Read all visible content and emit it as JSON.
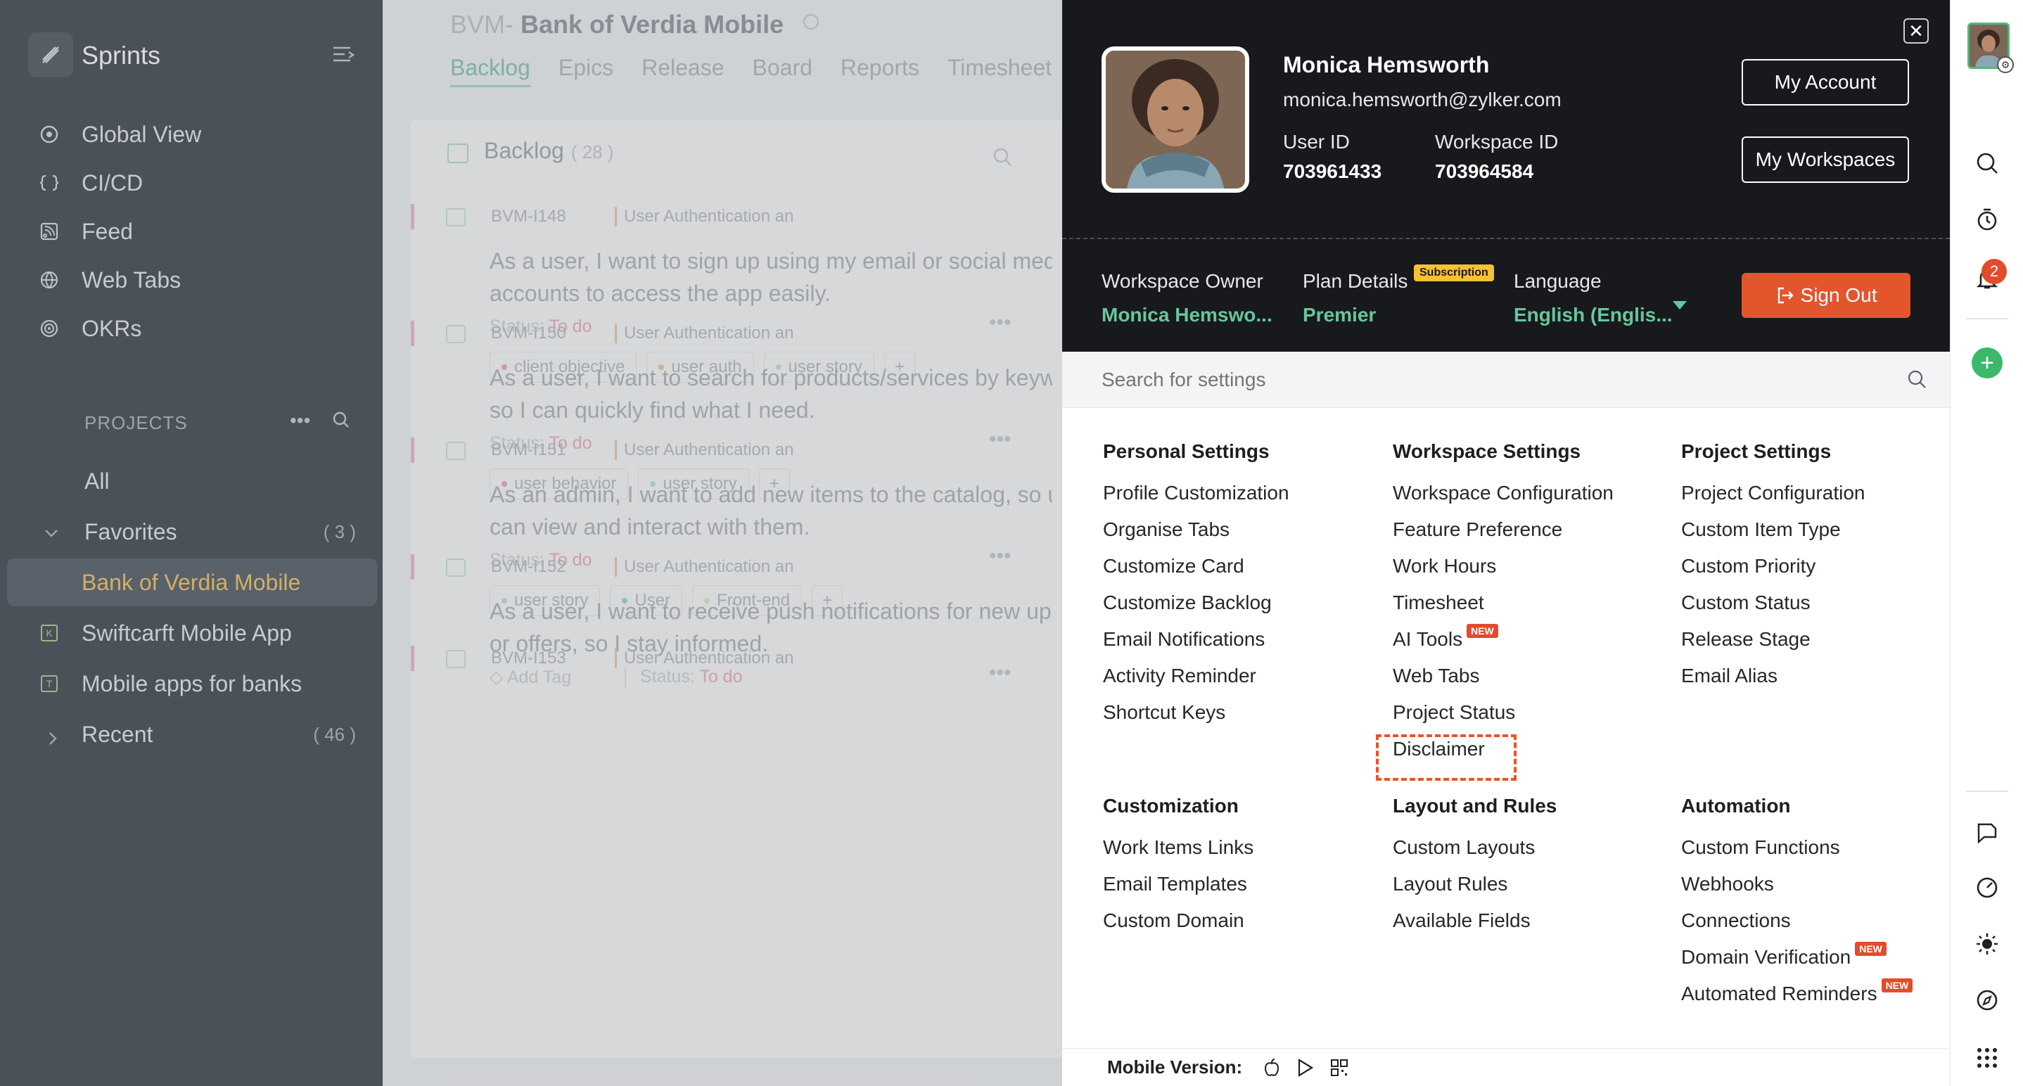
{
  "sidebar": {
    "title": "Sprints",
    "nav": [
      "Global View",
      "CI/CD",
      "Feed",
      "Web Tabs",
      "OKRs"
    ],
    "projects_label": "PROJECTS",
    "projects": [
      {
        "label": "All",
        "count": ""
      },
      {
        "label": "Favorites",
        "count": "( 3 )"
      },
      {
        "label": "Bank of Verdia Mobile",
        "count": ""
      },
      {
        "label": "Swiftcarft Mobile App",
        "count": ""
      },
      {
        "label": "Mobile apps for banks",
        "count": ""
      },
      {
        "label": "Recent",
        "count": "( 46 )"
      }
    ]
  },
  "project": {
    "prefix": "BVM-",
    "name": "Bank of Verdia Mobile",
    "tabs": [
      "Backlog",
      "Epics",
      "Release",
      "Board",
      "Reports",
      "Timesheet"
    ]
  },
  "backlog": {
    "title": "Backlog",
    "count": "( 28 )",
    "status_label": "Status:",
    "items": [
      {
        "id": "BVM-I148",
        "epic": "User Authentication an",
        "desc1": "As a user, I want to sign up using my email or social media",
        "desc2": "accounts to access the app easily.",
        "status": "To do",
        "tags": [
          "client objective",
          "user auth",
          "user story"
        ]
      },
      {
        "id": "BVM-I150",
        "epic": "User Authentication an",
        "desc1": "As a user, I want to search for products/services by keywo",
        "desc2": "so I can quickly find what I need.",
        "status": "To do",
        "tags": [
          "user behavior",
          "user story"
        ]
      },
      {
        "id": "BVM-I151",
        "epic": "User Authentication an",
        "desc1": "As an admin, I want to add new items to the catalog, so use",
        "desc2": "can view and interact with them.",
        "status": "To do",
        "tags": [
          "user story",
          "User",
          "Front-end"
        ]
      },
      {
        "id": "BVM-I152",
        "epic": "User Authentication an",
        "desc1": "As a user, I want to receive push notifications for new upd",
        "desc2": "or offers, so I stay informed.",
        "status": "To do",
        "add_tag": "Add Tag",
        "tags": []
      },
      {
        "id": "BVM-I153",
        "epic": "User Authentication an"
      }
    ]
  },
  "profile": {
    "name": "Monica Hemsworth",
    "email": "monica.hemsworth@zylker.com",
    "user_id_label": "User ID",
    "user_id": "703961433",
    "workspace_id_label": "Workspace ID",
    "workspace_id": "703964584",
    "my_account": "My Account",
    "my_workspaces": "My Workspaces",
    "owner_label": "Workspace Owner",
    "owner_value": "Monica Hemswo...",
    "plan_label": "Plan Details",
    "plan_badge": "Subscription",
    "plan_value": "Premier",
    "language_label": "Language",
    "language_value": "English (Englis...",
    "sign_out": "Sign Out"
  },
  "settings": {
    "search_placeholder": "Search for settings",
    "new_badge": "NEW",
    "personal": {
      "title": "Personal Settings",
      "items": [
        "Profile Customization",
        "Organise Tabs",
        "Customize Card",
        "Customize Backlog",
        "Email Notifications",
        "Activity Reminder",
        "Shortcut Keys"
      ]
    },
    "workspace": {
      "title": "Workspace Settings",
      "items": [
        "Workspace Configuration",
        "Feature Preference",
        "Work Hours",
        "Timesheet",
        "AI Tools",
        "Web Tabs",
        "Project Status",
        "Disclaimer"
      ]
    },
    "project": {
      "title": "Project Settings",
      "items": [
        "Project Configuration",
        "Custom Item Type",
        "Custom Priority",
        "Custom Status",
        "Release Stage",
        "Email Alias"
      ]
    },
    "customization": {
      "title": "Customization",
      "items": [
        "Work Items Links",
        "Email Templates",
        "Custom Domain"
      ]
    },
    "layout": {
      "title": "Layout and Rules",
      "items": [
        "Custom Layouts",
        "Layout Rules",
        "Available Fields"
      ]
    },
    "automation": {
      "title": "Automation",
      "items": [
        "Custom Functions",
        "Webhooks",
        "Connections",
        "Domain Verification",
        "Automated Reminders"
      ]
    },
    "mobile_label": "Mobile Version:"
  },
  "rail": {
    "notification_count": "2"
  },
  "colors": {
    "accent_green": "#68c69c",
    "sign_out": "#e2552d",
    "highlight": "#e8542c",
    "new_badge": "#e24b2b"
  }
}
